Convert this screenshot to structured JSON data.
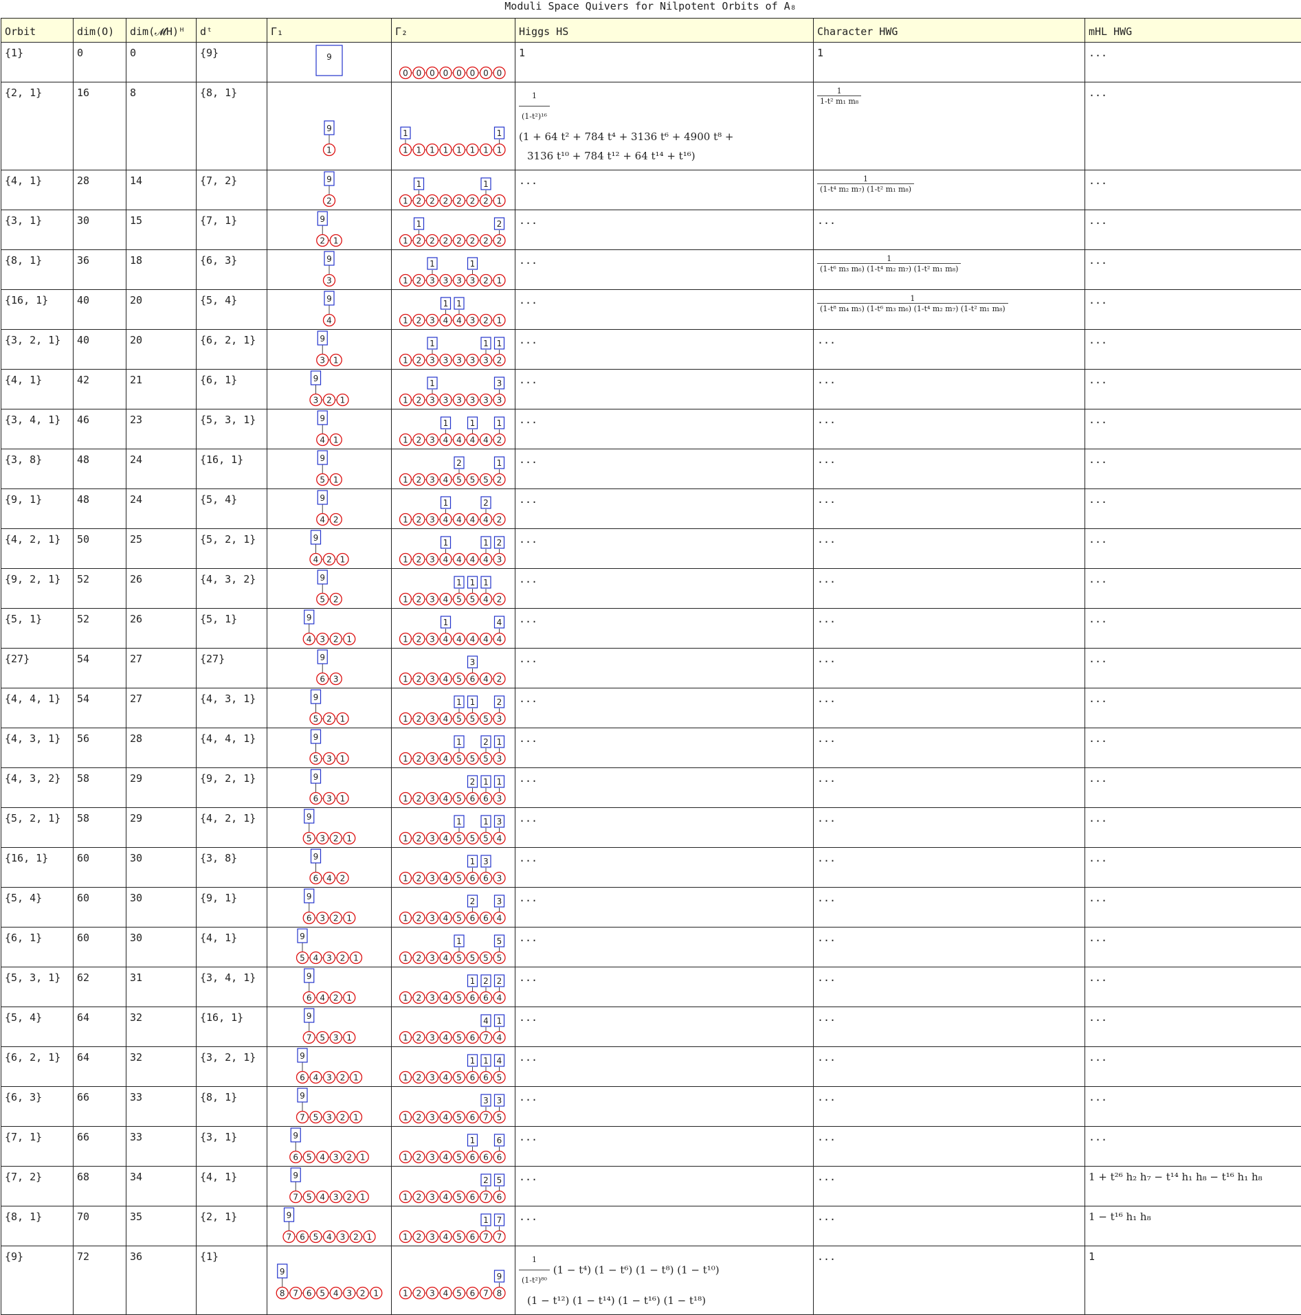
{
  "title": "Moduli Space Quivers for Nilpotent Orbits of A₈",
  "headers": [
    "Orbit",
    "dim(O)",
    "dim(𝓜H)ᴴ",
    "dᵗ",
    "Γ₁",
    "Γ₂",
    "Higgs HS",
    "Character HWG",
    "mHL HWG"
  ],
  "rows": [
    {
      "orbit": "{1}",
      "dimO": "0",
      "dimM": "0",
      "dt": "{9}",
      "g1": {
        "flavor": "9",
        "chain": [
          "0"
        ]
      },
      "g2": {
        "chain": [
          "0",
          "0",
          "0",
          "0",
          "0",
          "0",
          "0",
          "0"
        ],
        "flavors": []
      },
      "higgs": "1",
      "char": "1",
      "mhl": "..."
    },
    {
      "orbit": "{2, 1}",
      "dimO": "16",
      "dimM": "8",
      "dt": "{8, 1}",
      "g1": {
        "flavor": "9",
        "chain": [
          "1"
        ]
      },
      "g2": {
        "chain": [
          "1",
          "1",
          "1",
          "1",
          "1",
          "1",
          "1",
          "1"
        ],
        "flavors": [
          [
            "1",
            0
          ],
          [
            "1",
            7
          ]
        ]
      },
      "higgs_frac_num": "1",
      "higgs_frac_den": "(1-t²)¹⁶",
      "higgs_line1": "(1 + 64 t² + 784 t⁴ + 3136 t⁶ + 4900 t⁸ +",
      "higgs_line2": "3136 t¹⁰ + 784 t¹² + 64 t¹⁴ + t¹⁶)",
      "char_num": "1",
      "char_den": "1-t² m₁ m₈",
      "mhl": "..."
    },
    {
      "orbit": "{4, 1}",
      "dimO": "28",
      "dimM": "14",
      "dt": "{7, 2}",
      "g1": {
        "flavor": "9",
        "chain": [
          "2"
        ]
      },
      "g2": {
        "chain": [
          "1",
          "2",
          "2",
          "2",
          "2",
          "2",
          "2",
          "1"
        ],
        "flavors": [
          [
            "1",
            1
          ],
          [
            "1",
            6
          ]
        ]
      },
      "higgs": "...",
      "char_num": "1",
      "char_den": "(1-t⁴ m₂ m₇) (1-t² m₁ m₈)",
      "mhl": "..."
    },
    {
      "orbit": "{3, 1}",
      "dimO": "30",
      "dimM": "15",
      "dt": "{7, 1}",
      "g1": {
        "flavor": "9",
        "chain": [
          "2",
          "1"
        ]
      },
      "g2": {
        "chain": [
          "1",
          "2",
          "2",
          "2",
          "2",
          "2",
          "2",
          "2"
        ],
        "flavors": [
          [
            "1",
            1
          ],
          [
            "2",
            7
          ]
        ]
      },
      "higgs": "...",
      "char": "...",
      "mhl": "..."
    },
    {
      "orbit": "{8, 1}",
      "dimO": "36",
      "dimM": "18",
      "dt": "{6, 3}",
      "g1": {
        "flavor": "9",
        "chain": [
          "3"
        ]
      },
      "g2": {
        "chain": [
          "1",
          "2",
          "3",
          "3",
          "3",
          "3",
          "2",
          "1"
        ],
        "flavors": [
          [
            "1",
            2
          ],
          [
            "1",
            5
          ]
        ]
      },
      "higgs": "...",
      "char_num": "1",
      "char_den": "(1-t⁶ m₃ m₆) (1-t⁴ m₂ m₇) (1-t² m₁ m₈)",
      "mhl": "..."
    },
    {
      "orbit": "{16, 1}",
      "dimO": "40",
      "dimM": "20",
      "dt": "{5, 4}",
      "g1": {
        "flavor": "9",
        "chain": [
          "4"
        ]
      },
      "g2": {
        "chain": [
          "1",
          "2",
          "3",
          "4",
          "4",
          "3",
          "2",
          "1"
        ],
        "flavors": [
          [
            "1",
            3
          ],
          [
            "1",
            4
          ]
        ]
      },
      "higgs": "...",
      "char_num": "1",
      "char_den": "(1-t⁸ m₄ m₅) (1-t⁶ m₃ m₆) (1-t⁴ m₂ m₇) (1-t² m₁ m₈)",
      "mhl": "..."
    },
    {
      "orbit": "{3, 2, 1}",
      "dimO": "40",
      "dimM": "20",
      "dt": "{6, 2, 1}",
      "g1": {
        "flavor": "9",
        "chain": [
          "3",
          "1"
        ]
      },
      "g2": {
        "chain": [
          "1",
          "2",
          "3",
          "3",
          "3",
          "3",
          "3",
          "2"
        ],
        "flavors": [
          [
            "1",
            2
          ],
          [
            "1",
            6
          ],
          [
            "1",
            7
          ]
        ]
      },
      "higgs": "...",
      "char": "...",
      "mhl": "..."
    },
    {
      "orbit": "{4, 1}",
      "dimO": "42",
      "dimM": "21",
      "dt": "{6, 1}",
      "g1": {
        "flavor": "9",
        "chain": [
          "3",
          "2",
          "1"
        ]
      },
      "g2": {
        "chain": [
          "1",
          "2",
          "3",
          "3",
          "3",
          "3",
          "3",
          "3"
        ],
        "flavors": [
          [
            "1",
            2
          ],
          [
            "3",
            7
          ]
        ]
      },
      "higgs": "...",
      "char": "...",
      "mhl": "..."
    },
    {
      "orbit": "{3, 4, 1}",
      "dimO": "46",
      "dimM": "23",
      "dt": "{5, 3, 1}",
      "g1": {
        "flavor": "9",
        "chain": [
          "4",
          "1"
        ]
      },
      "g2": {
        "chain": [
          "1",
          "2",
          "3",
          "4",
          "4",
          "4",
          "4",
          "2"
        ],
        "flavors": [
          [
            "1",
            3
          ],
          [
            "1",
            5
          ],
          [
            "1",
            7
          ]
        ]
      },
      "higgs": "...",
      "char": "...",
      "mhl": "..."
    },
    {
      "orbit": "{3, 8}",
      "dimO": "48",
      "dimM": "24",
      "dt": "{16, 1}",
      "g1": {
        "flavor": "9",
        "chain": [
          "5",
          "1"
        ]
      },
      "g2": {
        "chain": [
          "1",
          "2",
          "3",
          "4",
          "5",
          "5",
          "5",
          "2"
        ],
        "flavors": [
          [
            "2",
            4
          ],
          [
            "1",
            7
          ]
        ]
      },
      "higgs": "...",
      "char": "...",
      "mhl": "..."
    },
    {
      "orbit": "{9, 1}",
      "dimO": "48",
      "dimM": "24",
      "dt": "{5, 4}",
      "g1": {
        "flavor": "9",
        "chain": [
          "4",
          "2"
        ]
      },
      "g2": {
        "chain": [
          "1",
          "2",
          "3",
          "4",
          "4",
          "4",
          "4",
          "2"
        ],
        "flavors": [
          [
            "1",
            3
          ],
          [
            "2",
            6
          ]
        ]
      },
      "higgs": "...",
      "char": "...",
      "mhl": "..."
    },
    {
      "orbit": "{4, 2, 1}",
      "dimO": "50",
      "dimM": "25",
      "dt": "{5, 2, 1}",
      "g1": {
        "flavor": "9",
        "chain": [
          "4",
          "2",
          "1"
        ]
      },
      "g2": {
        "chain": [
          "1",
          "2",
          "3",
          "4",
          "4",
          "4",
          "4",
          "3"
        ],
        "flavors": [
          [
            "1",
            3
          ],
          [
            "1",
            6
          ],
          [
            "2",
            7
          ]
        ]
      },
      "higgs": "...",
      "char": "...",
      "mhl": "..."
    },
    {
      "orbit": "{9, 2, 1}",
      "dimO": "52",
      "dimM": "26",
      "dt": "{4, 3, 2}",
      "g1": {
        "flavor": "9",
        "chain": [
          "5",
          "2"
        ]
      },
      "g2": {
        "chain": [
          "1",
          "2",
          "3",
          "4",
          "5",
          "5",
          "4",
          "2"
        ],
        "flavors": [
          [
            "1",
            4
          ],
          [
            "1",
            5
          ],
          [
            "1",
            6
          ]
        ]
      },
      "higgs": "...",
      "char": "...",
      "mhl": "..."
    },
    {
      "orbit": "{5, 1}",
      "dimO": "52",
      "dimM": "26",
      "dt": "{5, 1}",
      "g1": {
        "flavor": "9",
        "chain": [
          "4",
          "3",
          "2",
          "1"
        ]
      },
      "g2": {
        "chain": [
          "1",
          "2",
          "3",
          "4",
          "4",
          "4",
          "4",
          "4"
        ],
        "flavors": [
          [
            "1",
            3
          ],
          [
            "4",
            7
          ]
        ]
      },
      "higgs": "...",
      "char": "...",
      "mhl": "..."
    },
    {
      "orbit": "{27}",
      "dimO": "54",
      "dimM": "27",
      "dt": "{27}",
      "g1": {
        "flavor": "9",
        "chain": [
          "6",
          "3"
        ]
      },
      "g2": {
        "chain": [
          "1",
          "2",
          "3",
          "4",
          "5",
          "6",
          "4",
          "2"
        ],
        "flavors": [
          [
            "3",
            5
          ]
        ]
      },
      "higgs": "...",
      "char": "...",
      "mhl": "..."
    },
    {
      "orbit": "{4, 4, 1}",
      "dimO": "54",
      "dimM": "27",
      "dt": "{4, 3, 1}",
      "g1": {
        "flavor": "9",
        "chain": [
          "5",
          "2",
          "1"
        ]
      },
      "g2": {
        "chain": [
          "1",
          "2",
          "3",
          "4",
          "5",
          "5",
          "5",
          "3"
        ],
        "flavors": [
          [
            "1",
            4
          ],
          [
            "1",
            5
          ],
          [
            "2",
            7
          ]
        ]
      },
      "higgs": "...",
      "char": "...",
      "mhl": "..."
    },
    {
      "orbit": "{4, 3, 1}",
      "dimO": "56",
      "dimM": "28",
      "dt": "{4, 4, 1}",
      "g1": {
        "flavor": "9",
        "chain": [
          "5",
          "3",
          "1"
        ]
      },
      "g2": {
        "chain": [
          "1",
          "2",
          "3",
          "4",
          "5",
          "5",
          "5",
          "3"
        ],
        "flavors": [
          [
            "1",
            4
          ],
          [
            "2",
            6
          ],
          [
            "1",
            7
          ]
        ]
      },
      "higgs": "...",
      "char": "...",
      "mhl": "..."
    },
    {
      "orbit": "{4, 3, 2}",
      "dimO": "58",
      "dimM": "29",
      "dt": "{9, 2, 1}",
      "g1": {
        "flavor": "9",
        "chain": [
          "6",
          "3",
          "1"
        ]
      },
      "g2": {
        "chain": [
          "1",
          "2",
          "3",
          "4",
          "5",
          "6",
          "6",
          "3"
        ],
        "flavors": [
          [
            "2",
            5
          ],
          [
            "1",
            6
          ],
          [
            "1",
            7
          ]
        ]
      },
      "higgs": "...",
      "char": "...",
      "mhl": "..."
    },
    {
      "orbit": "{5, 2, 1}",
      "dimO": "58",
      "dimM": "29",
      "dt": "{4, 2, 1}",
      "g1": {
        "flavor": "9",
        "chain": [
          "5",
          "3",
          "2",
          "1"
        ]
      },
      "g2": {
        "chain": [
          "1",
          "2",
          "3",
          "4",
          "5",
          "5",
          "5",
          "4"
        ],
        "flavors": [
          [
            "1",
            4
          ],
          [
            "1",
            6
          ],
          [
            "3",
            7
          ]
        ]
      },
      "higgs": "...",
      "char": "...",
      "mhl": "..."
    },
    {
      "orbit": "{16, 1}",
      "dimO": "60",
      "dimM": "30",
      "dt": "{3, 8}",
      "g1": {
        "flavor": "9",
        "chain": [
          "6",
          "4",
          "2"
        ]
      },
      "g2": {
        "chain": [
          "1",
          "2",
          "3",
          "4",
          "5",
          "6",
          "6",
          "3"
        ],
        "flavors": [
          [
            "1",
            5
          ],
          [
            "3",
            6
          ]
        ]
      },
      "higgs": "...",
      "char": "...",
      "mhl": "..."
    },
    {
      "orbit": "{5, 4}",
      "dimO": "60",
      "dimM": "30",
      "dt": "{9, 1}",
      "g1": {
        "flavor": "9",
        "chain": [
          "6",
          "3",
          "2",
          "1"
        ]
      },
      "g2": {
        "chain": [
          "1",
          "2",
          "3",
          "4",
          "5",
          "6",
          "6",
          "4"
        ],
        "flavors": [
          [
            "2",
            5
          ],
          [
            "3",
            7
          ]
        ]
      },
      "higgs": "...",
      "char": "...",
      "mhl": "..."
    },
    {
      "orbit": "{6, 1}",
      "dimO": "60",
      "dimM": "30",
      "dt": "{4, 1}",
      "g1": {
        "flavor": "9",
        "chain": [
          "5",
          "4",
          "3",
          "2",
          "1"
        ]
      },
      "g2": {
        "chain": [
          "1",
          "2",
          "3",
          "4",
          "5",
          "5",
          "5",
          "5"
        ],
        "flavors": [
          [
            "1",
            4
          ],
          [
            "5",
            7
          ]
        ]
      },
      "higgs": "...",
      "char": "...",
      "mhl": "..."
    },
    {
      "orbit": "{5, 3, 1}",
      "dimO": "62",
      "dimM": "31",
      "dt": "{3, 4, 1}",
      "g1": {
        "flavor": "9",
        "chain": [
          "6",
          "4",
          "2",
          "1"
        ]
      },
      "g2": {
        "chain": [
          "1",
          "2",
          "3",
          "4",
          "5",
          "6",
          "6",
          "4"
        ],
        "flavors": [
          [
            "1",
            5
          ],
          [
            "2",
            6
          ],
          [
            "2",
            7
          ]
        ]
      },
      "higgs": "...",
      "char": "...",
      "mhl": "..."
    },
    {
      "orbit": "{5, 4}",
      "dimO": "64",
      "dimM": "32",
      "dt": "{16, 1}",
      "g1": {
        "flavor": "9",
        "chain": [
          "7",
          "5",
          "3",
          "1"
        ]
      },
      "g2": {
        "chain": [
          "1",
          "2",
          "3",
          "4",
          "5",
          "6",
          "7",
          "4"
        ],
        "flavors": [
          [
            "4",
            6
          ],
          [
            "1",
            7
          ]
        ]
      },
      "higgs": "...",
      "char": "...",
      "mhl": "..."
    },
    {
      "orbit": "{6, 2, 1}",
      "dimO": "64",
      "dimM": "32",
      "dt": "{3, 2, 1}",
      "g1": {
        "flavor": "9",
        "chain": [
          "6",
          "4",
          "3",
          "2",
          "1"
        ]
      },
      "g2": {
        "chain": [
          "1",
          "2",
          "3",
          "4",
          "5",
          "6",
          "6",
          "5"
        ],
        "flavors": [
          [
            "1",
            5
          ],
          [
            "1",
            6
          ],
          [
            "4",
            7
          ]
        ]
      },
      "higgs": "...",
      "char": "...",
      "mhl": "..."
    },
    {
      "orbit": "{6, 3}",
      "dimO": "66",
      "dimM": "33",
      "dt": "{8, 1}",
      "g1": {
        "flavor": "9",
        "chain": [
          "7",
          "5",
          "3",
          "2",
          "1"
        ]
      },
      "g2": {
        "chain": [
          "1",
          "2",
          "3",
          "4",
          "5",
          "6",
          "7",
          "5"
        ],
        "flavors": [
          [
            "3",
            6
          ],
          [
            "3",
            7
          ]
        ]
      },
      "higgs": "...",
      "char": "...",
      "mhl": "..."
    },
    {
      "orbit": "{7, 1}",
      "dimO": "66",
      "dimM": "33",
      "dt": "{3, 1}",
      "g1": {
        "flavor": "9",
        "chain": [
          "6",
          "5",
          "4",
          "3",
          "2",
          "1"
        ]
      },
      "g2": {
        "chain": [
          "1",
          "2",
          "3",
          "4",
          "5",
          "6",
          "6",
          "6"
        ],
        "flavors": [
          [
            "1",
            5
          ],
          [
            "6",
            7
          ]
        ]
      },
      "higgs": "...",
      "char": "...",
      "mhl": "..."
    },
    {
      "orbit": "{7, 2}",
      "dimO": "68",
      "dimM": "34",
      "dt": "{4, 1}",
      "g1": {
        "flavor": "9",
        "chain": [
          "7",
          "5",
          "4",
          "3",
          "2",
          "1"
        ]
      },
      "g2": {
        "chain": [
          "1",
          "2",
          "3",
          "4",
          "5",
          "6",
          "7",
          "6"
        ],
        "flavors": [
          [
            "2",
            6
          ],
          [
            "5",
            7
          ]
        ]
      },
      "higgs": "...",
      "char": "...",
      "mhl": "1 + t²⁶ h₂ h₇ − t¹⁴ h₁ h₈ − t¹⁶ h₁ h₈"
    },
    {
      "orbit": "{8, 1}",
      "dimO": "70",
      "dimM": "35",
      "dt": "{2, 1}",
      "g1": {
        "flavor": "9",
        "chain": [
          "7",
          "6",
          "5",
          "4",
          "3",
          "2",
          "1"
        ]
      },
      "g2": {
        "chain": [
          "1",
          "2",
          "3",
          "4",
          "5",
          "6",
          "7",
          "7"
        ],
        "flavors": [
          [
            "1",
            6
          ],
          [
            "7",
            7
          ]
        ]
      },
      "higgs": "...",
      "char": "...",
      "mhl": "1 − t¹⁶ h₁ h₈"
    },
    {
      "orbit": "{9}",
      "dimO": "72",
      "dimM": "36",
      "dt": "{1}",
      "g1": {
        "flavor": "9",
        "chain": [
          "8",
          "7",
          "6",
          "5",
          "4",
          "3",
          "2",
          "1"
        ]
      },
      "g2": {
        "chain": [
          "1",
          "2",
          "3",
          "4",
          "5",
          "6",
          "7",
          "8"
        ],
        "flavors": [
          [
            "9",
            7
          ]
        ]
      },
      "higgs_frac_num": "1",
      "higgs_frac_den": "(1-t²)⁸⁰",
      "higgs_line1": "(1 − t⁴) (1 − t⁶) (1 − t⁸) (1 − t¹⁰)",
      "higgs_line2": "(1 − t¹²) (1 − t¹⁴) (1 − t¹⁶) (1 − t¹⁸)",
      "char": "...",
      "mhl": "1"
    }
  ]
}
